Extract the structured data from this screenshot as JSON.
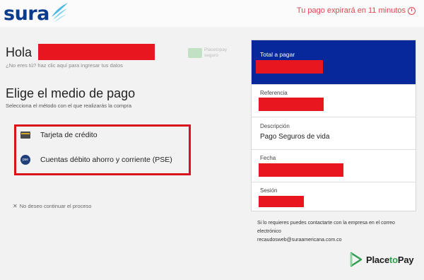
{
  "header": {
    "logo_text": "sura",
    "timer_text": "Tu pago expirará en 11 minutos",
    "colors": {
      "brand_blue": "#0a3b8c",
      "timer_red": "#e0454e"
    }
  },
  "greeting": {
    "hello": "Hola",
    "not_you": "¿No eres tú? haz clic aquí para ingresar tus datos",
    "badge_line1": "Placetopay",
    "badge_line2": "seguro"
  },
  "payment_methods": {
    "title": "Elige el medio de pago",
    "subtitle": "Selecciona el método con el que realizarás la compra",
    "items": [
      {
        "label": "Tarjeta de crédito",
        "icon": "credit-card-icon"
      },
      {
        "label": "Cuentas débito ahorro y corriente (PSE)",
        "icon": "pse-icon"
      }
    ],
    "cancel": "No deseo continuar el proceso"
  },
  "summary": {
    "total_label": "Total a pagar",
    "reference_label": "Referencia",
    "description_label": "Descripción",
    "description_value": "Pago Seguros de vida",
    "date_label": "Fecha",
    "session_label": "Sesión",
    "colors": {
      "total_bg": "#06289a",
      "redaction": "#e8161f"
    }
  },
  "contact": {
    "text": "Si lo requieres puedes contactarte con la empresa en el correo electrónico",
    "email": "recaudosweb@suraamericana.com.co"
  },
  "brand": {
    "part1": "Place",
    "part2": "to",
    "part3": "Pay"
  }
}
